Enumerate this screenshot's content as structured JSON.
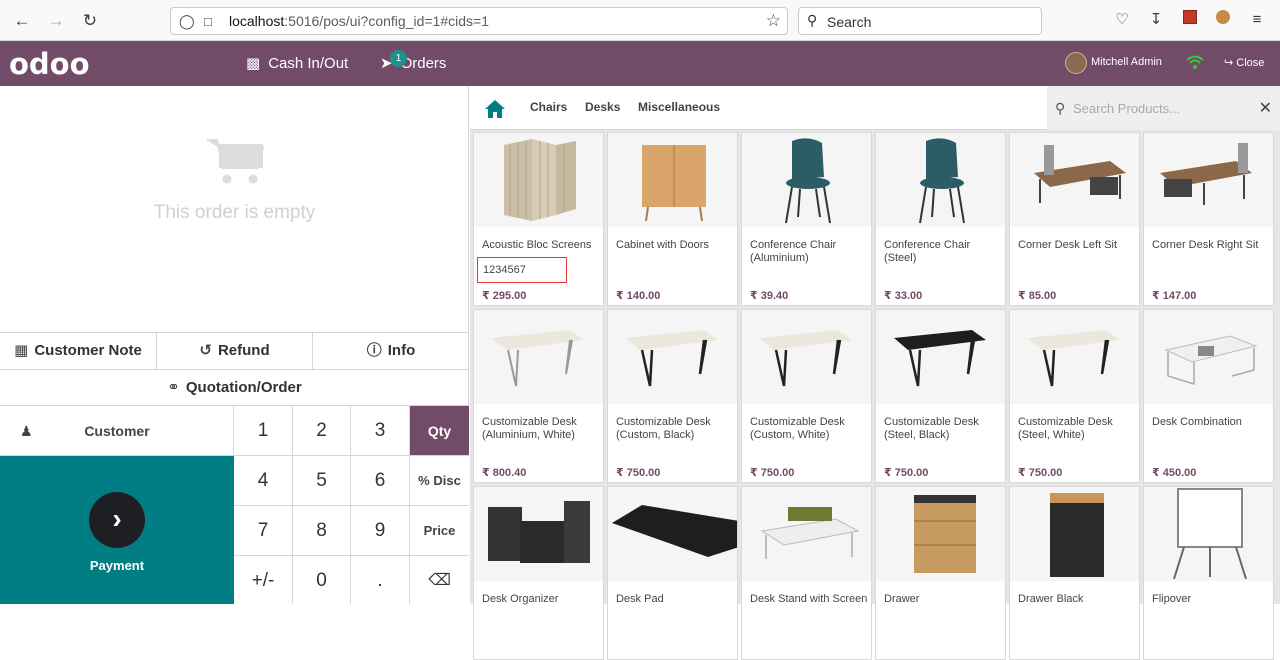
{
  "browser": {
    "url_host": "localhost",
    "url_path": ":5016/pos/ui?config_id=1#cids=1",
    "search_label": "Search"
  },
  "header": {
    "logo": "odoo",
    "cash_label": "Cash In/Out",
    "orders_label": "Orders",
    "orders_count": "1",
    "user_name": "Mitchell Admin",
    "close_label": "Close"
  },
  "order": {
    "empty_text": "This order is empty"
  },
  "controls": {
    "customer_note": "Customer Note",
    "refund": "Refund",
    "info": "Info",
    "quotation": "Quotation/Order"
  },
  "numpad": {
    "customer": "Customer",
    "payment": "Payment",
    "keys": [
      "1",
      "2",
      "3",
      "Qty",
      "4",
      "5",
      "6",
      "% Disc",
      "7",
      "8",
      "9",
      "Price",
      "+/-",
      "0",
      "."
    ],
    "active_key": "Qty"
  },
  "categories": {
    "items": [
      "Chairs",
      "Desks",
      "Miscellaneous"
    ],
    "search_placeholder": "Search Products..."
  },
  "products": [
    {
      "name": "Acoustic Bloc Screens",
      "price": "₹ 295.00",
      "barcode": "1234567"
    },
    {
      "name": "Cabinet with Doors",
      "price": "₹ 140.00"
    },
    {
      "name": "Conference Chair (Aluminium)",
      "price": "₹ 39.40"
    },
    {
      "name": "Conference Chair (Steel)",
      "price": "₹ 33.00"
    },
    {
      "name": "Corner Desk Left Sit",
      "price": "₹ 85.00"
    },
    {
      "name": "Corner Desk Right Sit",
      "price": "₹ 147.00"
    },
    {
      "name": "Customizable Desk (Aluminium, White)",
      "price": "₹ 800.40"
    },
    {
      "name": "Customizable Desk (Custom, Black)",
      "price": "₹ 750.00"
    },
    {
      "name": "Customizable Desk (Custom, White)",
      "price": "₹ 750.00"
    },
    {
      "name": "Customizable Desk (Steel, Black)",
      "price": "₹ 750.00"
    },
    {
      "name": "Customizable Desk (Steel, White)",
      "price": "₹ 750.00"
    },
    {
      "name": "Desk Combination",
      "price": "₹ 450.00"
    },
    {
      "name": "Desk Organizer",
      "price": ""
    },
    {
      "name": "Desk Pad",
      "price": ""
    },
    {
      "name": "Desk Stand with Screen",
      "price": ""
    },
    {
      "name": "Drawer",
      "price": ""
    },
    {
      "name": "Drawer Black",
      "price": ""
    },
    {
      "name": "Flipover",
      "price": ""
    }
  ],
  "colors": {
    "brand": "#714b67",
    "teal": "#017e84",
    "badge": "#1c9393"
  }
}
